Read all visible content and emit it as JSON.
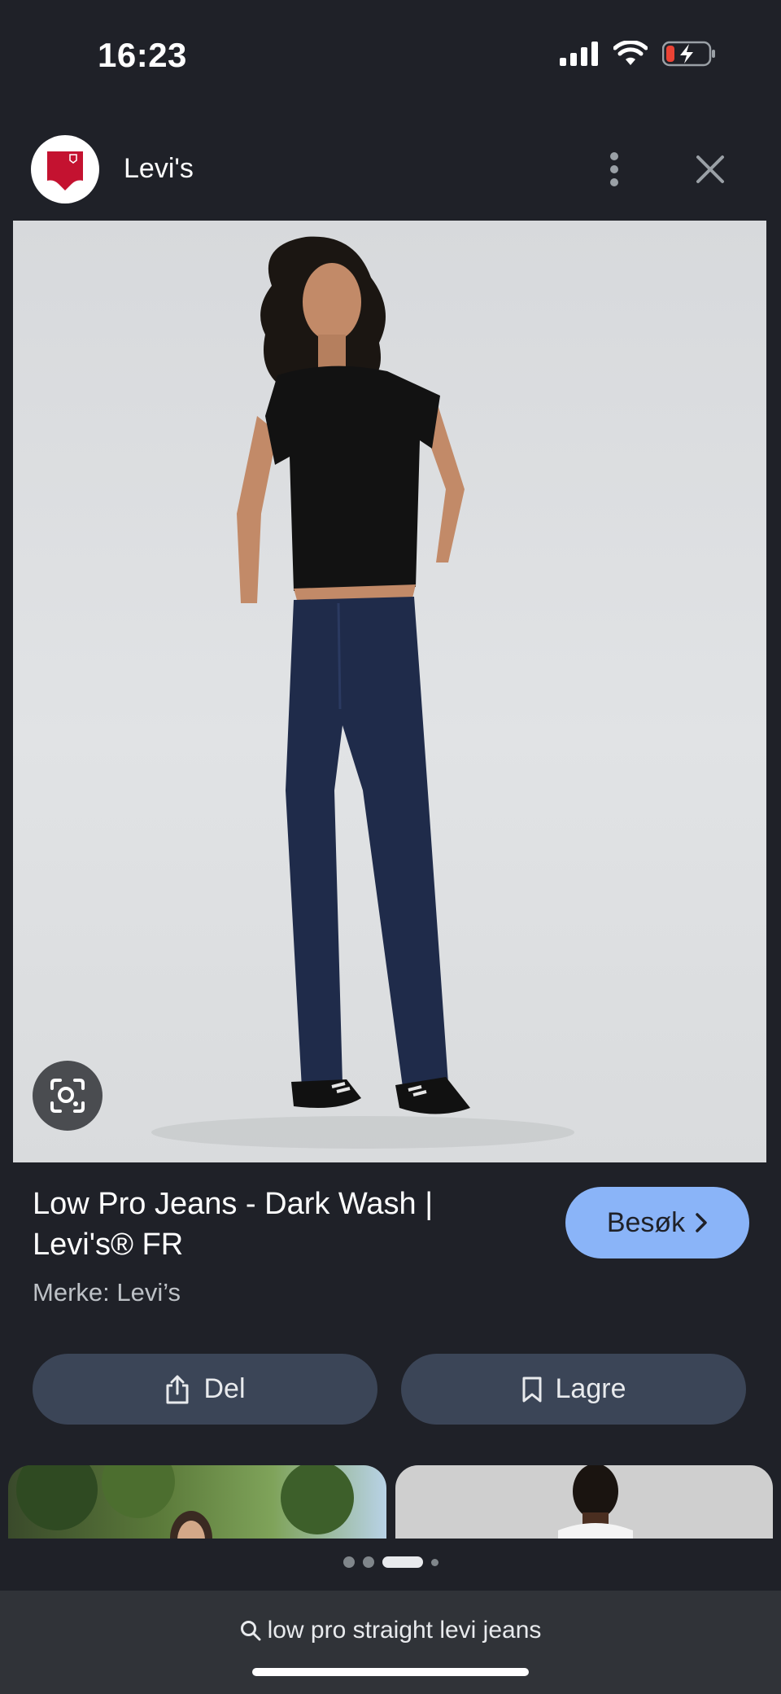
{
  "status_bar": {
    "time": "16:23"
  },
  "source": {
    "name": "Levi's"
  },
  "product": {
    "title_line1": "Low Pro Jeans - Dark Wash |",
    "title_line2": "Levi's® FR",
    "brand": "Merke: Levi’s"
  },
  "actions": {
    "visit_label": "Besøk",
    "share_label": "Del",
    "save_label": "Lagre"
  },
  "pager": {
    "count": 4,
    "active_index": 2
  },
  "search": {
    "query": "low pro straight levi jeans"
  },
  "colors": {
    "background": "#1f2128",
    "visit_button": "#8ab4f8",
    "pill_button": "#3b4557",
    "search_bar": "#303338",
    "levis_red": "#c41230"
  }
}
